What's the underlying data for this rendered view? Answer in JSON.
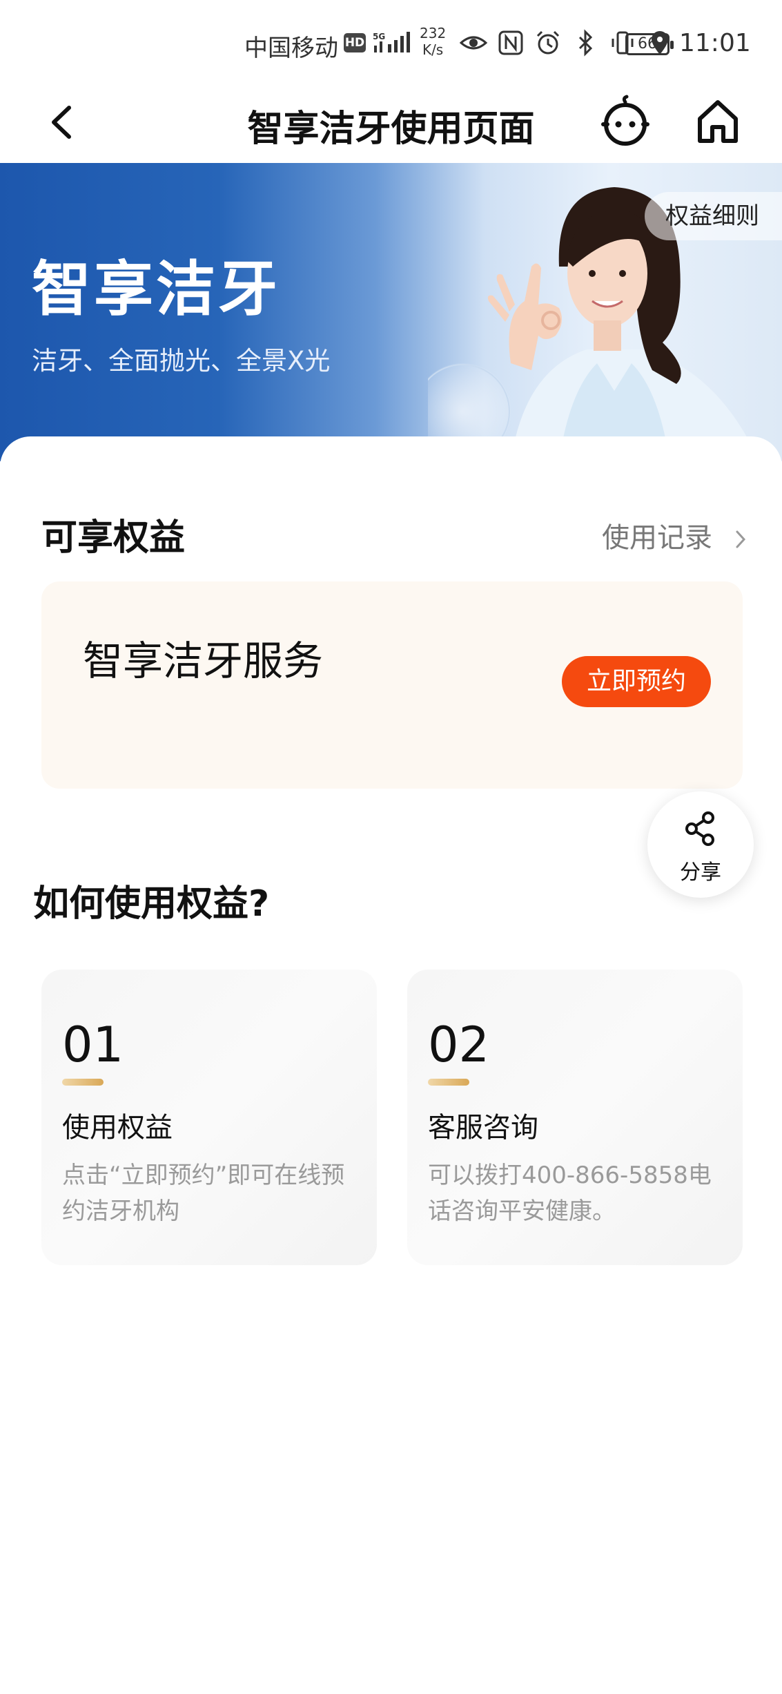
{
  "status_bar": {
    "carrier": "中国移动",
    "hd_badge": "HD",
    "net_speed_value": "232",
    "net_speed_unit": "K/s",
    "battery": "66",
    "time": "11:01"
  },
  "nav": {
    "title": "智享洁牙使用页面",
    "icons": [
      "back-arrow-icon",
      "robot-assistant-icon",
      "home-icon"
    ]
  },
  "banner": {
    "title": "智享洁牙",
    "subtitle": "洁牙、全面抛光、全景X光",
    "rules_button": "权益细则"
  },
  "benefits": {
    "title": "可享权益",
    "usage_link": "使用记录",
    "service_name": "智享洁牙服务",
    "book_button": "立即预约"
  },
  "share": {
    "label": "分享"
  },
  "howto": {
    "title": "如何使用权益?",
    "steps": [
      {
        "num": "01",
        "title": "使用权益",
        "desc": "点击“立即预约”即可在线预约洁牙机构"
      },
      {
        "num": "02",
        "title": "客服咨询",
        "desc": "可以拨打400-866-5858电话咨询平安健康。"
      }
    ]
  },
  "colors": {
    "accent_orange": "#f54a0f",
    "banner_blue": "#1d57ad",
    "card_cream": "#fdf8f2",
    "step_bar_gold": "#d9a857"
  }
}
